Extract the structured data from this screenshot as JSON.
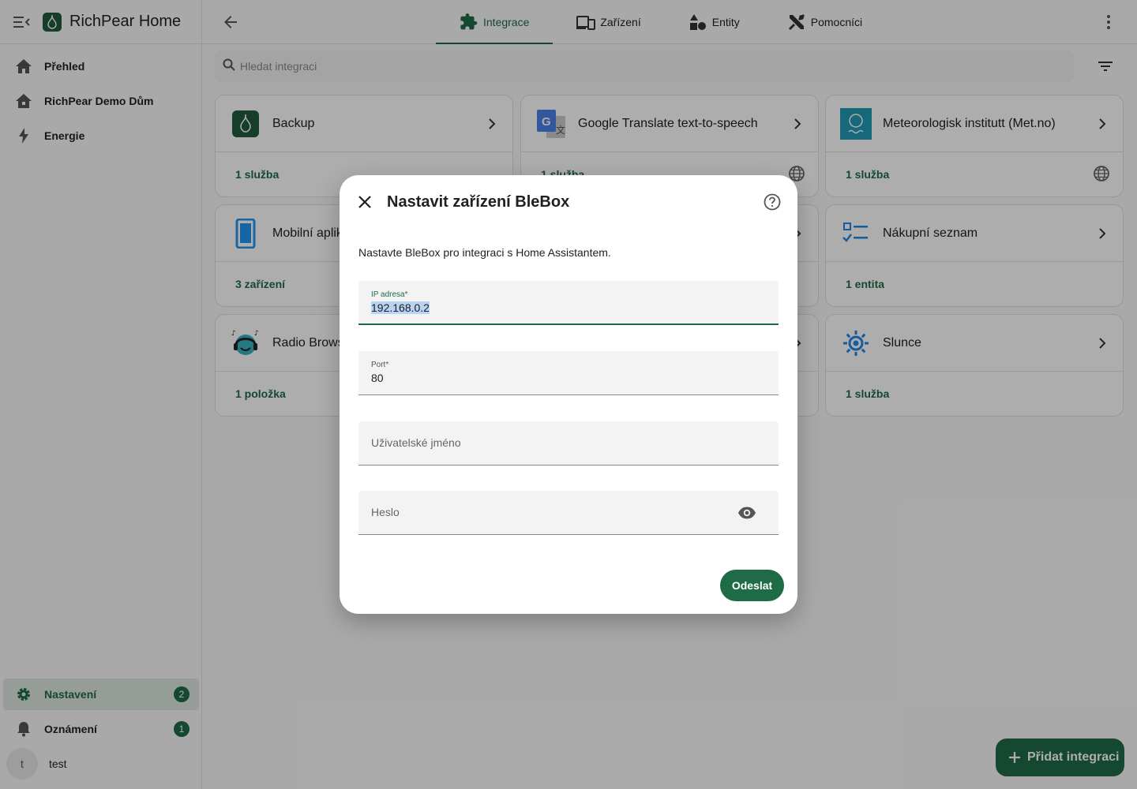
{
  "app": {
    "title": "RichPear Home"
  },
  "sidebar": {
    "items": [
      {
        "label": "Přehled",
        "icon": "home-icon"
      },
      {
        "label": "RichPear Demo Dům",
        "icon": "home-roof-icon"
      },
      {
        "label": "Energie",
        "icon": "lightning-icon"
      }
    ],
    "bottom": [
      {
        "label": "Nastavení",
        "icon": "gear-icon",
        "badge": "2"
      },
      {
        "label": "Oznámení",
        "icon": "bell-icon",
        "badge": "1"
      }
    ],
    "user": {
      "initial": "t",
      "name": "test"
    }
  },
  "tabs": [
    {
      "label": "Integrace",
      "icon": "puzzle-icon"
    },
    {
      "label": "Zařízení",
      "icon": "devices-icon"
    },
    {
      "label": "Entity",
      "icon": "shapes-icon"
    },
    {
      "label": "Pomocníci",
      "icon": "tools-icon"
    }
  ],
  "search": {
    "placeholder": "Hledat integraci"
  },
  "cards": [
    {
      "name": "Backup",
      "footer": "1 služba"
    },
    {
      "name": "Google Translate text-to-speech",
      "footer": "1 služba"
    },
    {
      "name": "Meteorologisk institutt (Met.no)",
      "footer": "1 služba"
    },
    {
      "name": "Mobilní aplik",
      "footer": "3 zařízení"
    },
    {
      "name": "Nákupní seznam",
      "footer": "1 entita"
    },
    {
      "name": "Radio Brows",
      "footer": "1 položka"
    },
    {
      "name": "Slunce",
      "footer": "1 služba"
    }
  ],
  "fab": {
    "label": "Přidat integraci"
  },
  "dialog": {
    "title": "Nastavit zařízení BleBox",
    "description": "Nastavte BleBox pro integraci s Home Assistantem.",
    "fields": {
      "ip": {
        "label": "IP adresa*",
        "value": "192.168.0.2"
      },
      "port": {
        "label": "Port*",
        "value": "80"
      },
      "username": {
        "label": "Uživatelské jméno"
      },
      "password": {
        "label": "Heslo"
      }
    },
    "submit": "Odeslat"
  },
  "colors": {
    "primary": "#1f6b47",
    "background": "#fafafa"
  }
}
